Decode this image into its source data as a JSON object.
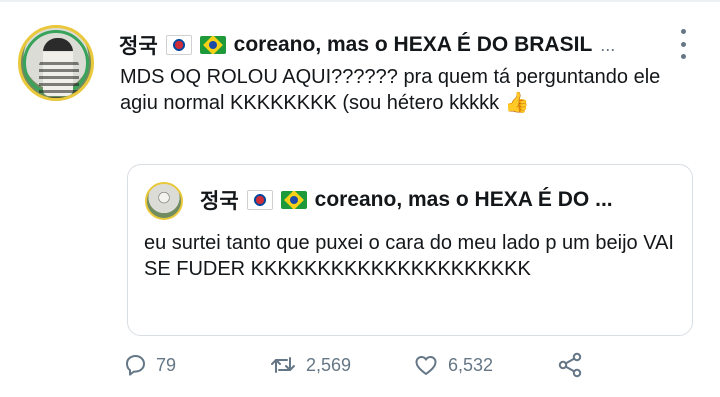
{
  "tweet": {
    "author_name": "정국",
    "author_suffix": "coreano, mas o HEXA É DO BRASIL",
    "author_ellipsis": "...",
    "text": "MDS OQ ROLOU AQUI?????? pra quem tá perguntando ele agiu normal KKKKKKKK (sou hétero kkkkk",
    "emoji": "👍"
  },
  "quoted": {
    "author_name": "정국",
    "author_suffix": "coreano, mas o HEXA É DO ...",
    "text": "eu surtei tanto que puxei o cara do meu lado p um beijo VAI SE FUDER KKKKKKKKKKKKKKKKKKKKK"
  },
  "actions": {
    "replies": "79",
    "retweets": "2,569",
    "likes": "6,532"
  },
  "icons": {
    "reply": "reply-icon",
    "retweet": "retweet-icon",
    "like": "like-icon",
    "share": "share-icon",
    "more": "more-options-icon",
    "flag_kr": "south-korea-flag-icon",
    "flag_br": "brazil-flag-icon"
  }
}
